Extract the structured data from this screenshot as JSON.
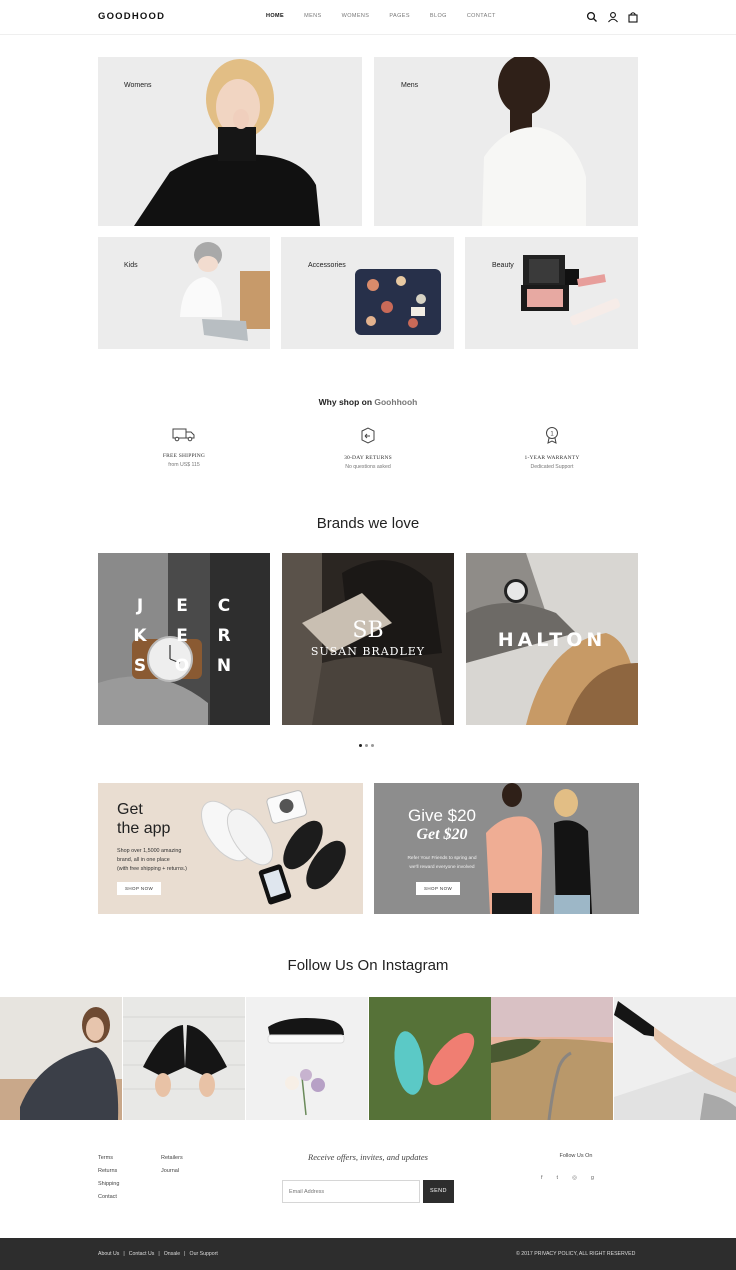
{
  "header": {
    "logo": "GOODHOOD",
    "nav": [
      "HOME",
      "MENS",
      "WOMENS",
      "PAGES",
      "BLOG",
      "CONTACT"
    ],
    "icons": [
      "search-icon",
      "user-icon",
      "bag-icon"
    ]
  },
  "categories": {
    "women": "Womens",
    "men": "Mens",
    "kids": "Kids",
    "accessories": "Accessories",
    "beauty": "Beauty"
  },
  "why": {
    "prefix": "Why shop on ",
    "brand": "Goohhooh",
    "features": [
      {
        "title": "FREE SHIPPING",
        "sub": "from US$ 115",
        "icon": "truck-icon"
      },
      {
        "title": "30-DAY RETURNS",
        "sub": "No questions asked",
        "icon": "return-box-icon"
      },
      {
        "title": "1-YEAR WARRANTY",
        "sub": "Dedicated Support",
        "icon": "award-icon"
      }
    ]
  },
  "brands": {
    "title": "Brands we love",
    "items": [
      {
        "name": "JECKERSON",
        "letters": [
          "J",
          "E",
          "C",
          "K",
          "E",
          "R",
          "S",
          "O",
          "N"
        ]
      },
      {
        "monogram": "SB",
        "name": "SUSAN BRADLEY"
      },
      {
        "name": "HALTON"
      }
    ],
    "slider_pages": 3,
    "slider_active": 1
  },
  "promo": {
    "app": {
      "title_line1": "Get",
      "title_line2": "the app",
      "body_line1": "Shop over 1,5000 amazing",
      "body_line2": "brand, all in one place",
      "body_line3": "(with free shipping + returns.)",
      "button": "SHOP NOW"
    },
    "gift": {
      "title_line1": "Give $20",
      "title_line2": "Get $20",
      "body_line1": "Refer Your Friends to spring and",
      "body_line2": "we'll reward everyone involved",
      "button": "SHOP NOW"
    }
  },
  "instagram": {
    "title": "Follow Us On Instagram"
  },
  "footer": {
    "col1": [
      "Terms",
      "Returns",
      "Shipping",
      "Contact"
    ],
    "col2": [
      "Retailers",
      "Journal"
    ],
    "newsletter_title": "Receive offers, invites, and updates",
    "email_placeholder": "Email Address",
    "send": "SEND",
    "follow": "Follow Us On",
    "social": [
      {
        "glyph": "f",
        "icon": "facebook-icon"
      },
      {
        "glyph": "t",
        "icon": "twitter-icon"
      },
      {
        "glyph": "◎",
        "icon": "instagram-icon"
      },
      {
        "glyph": "g",
        "icon": "google-plus-icon"
      }
    ],
    "bottom_links": [
      "About Us",
      "Contact Us",
      "Onsale",
      "Our Support"
    ],
    "copyright": "© 2017 PRIVACY POLICY, ALL RIGHT RESERVED"
  }
}
